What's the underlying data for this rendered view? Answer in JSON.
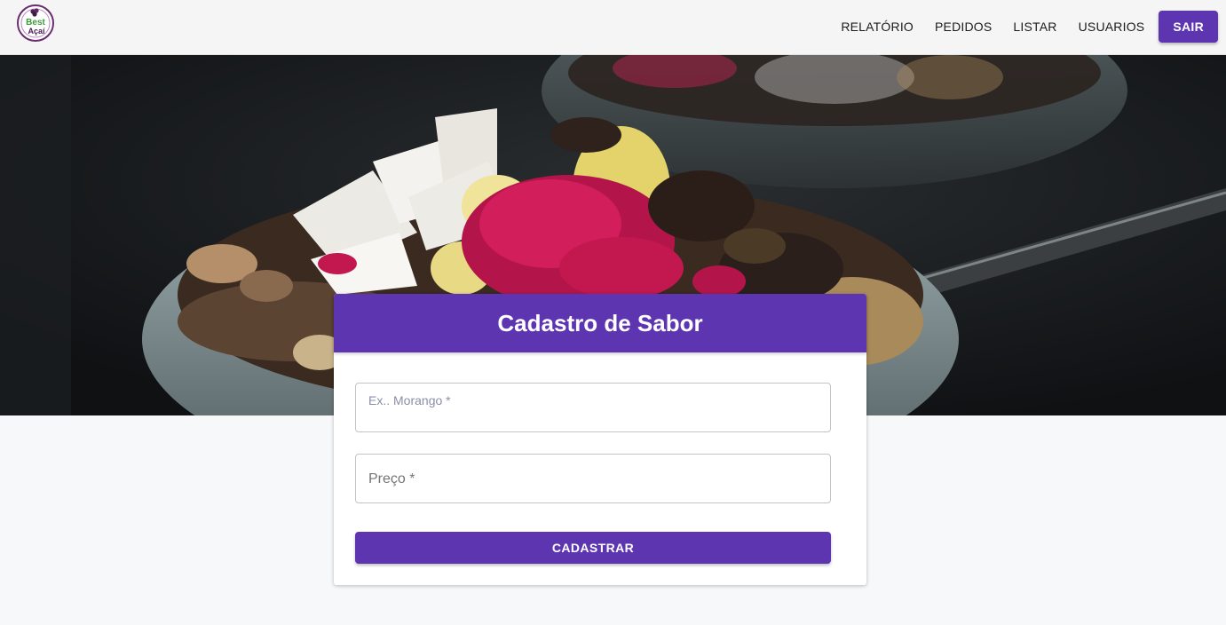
{
  "navbar": {
    "logo": {
      "icon": "best-acai-logo",
      "line1": "Best",
      "line2": "Açaí"
    },
    "links": [
      "RELATÓRIO",
      "PEDIDOS",
      "LISTAR",
      "USUARIOS"
    ],
    "logout_label": "SAIR"
  },
  "hero": {
    "image": "acai-bowl-photo"
  },
  "form": {
    "title": "Cadastro de Sabor",
    "flavor_placeholder": "Ex.. Morango *",
    "price_label": "Preço *",
    "submit_label": "CADASTRAR"
  },
  "colors": {
    "primary": "#5e35b1",
    "navbar_bg": "#f5f5f5",
    "page_bg": "#f7f8fa"
  }
}
